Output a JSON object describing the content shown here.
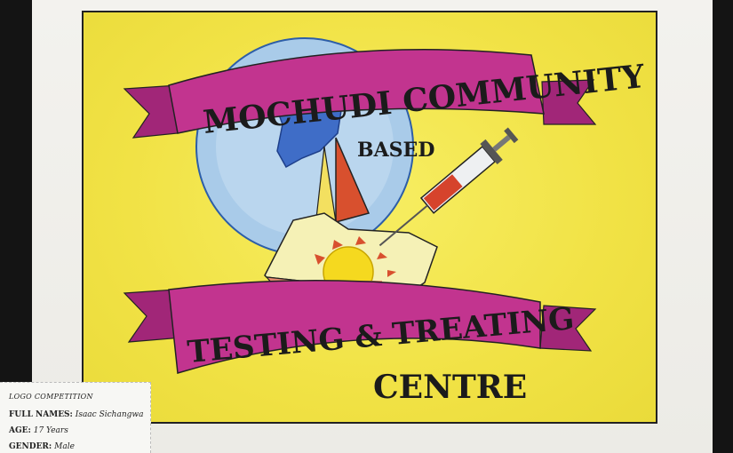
{
  "artwork": {
    "title_line_1": "MOCHUDI COMMUNITY",
    "title_line_2": "BASED",
    "title_line_3": "TESTING & TREATING",
    "title_line_4": "CENTRE",
    "colors": {
      "background": "#f1e245",
      "ribbon": "#c2348f",
      "globe": "#9cc2e6",
      "map": "#3f6dc7",
      "sail": "#d8502e",
      "sun": "#f5d91f"
    },
    "icons": [
      "globe-icon",
      "ribbon-banner",
      "syringe-icon",
      "sailboat-icon",
      "sun-icon"
    ]
  },
  "label": {
    "title": "LOGO COMPETITION",
    "full_names_key": "FULL NAMES:",
    "full_names_value": "Isaac Sichangwa",
    "age_key": "AGE:",
    "age_value": "17 Years",
    "gender_key": "GENDER:",
    "gender_value": "Male"
  }
}
